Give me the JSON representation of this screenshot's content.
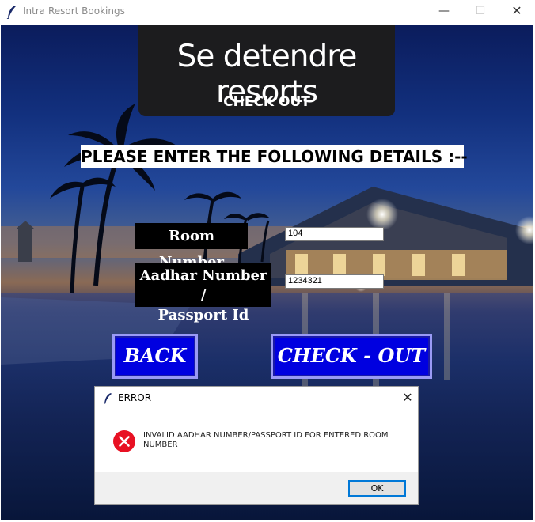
{
  "window": {
    "title": "Intra Resort Bookings",
    "icon": "feather-icon",
    "controls": {
      "minimize": "—",
      "maximize": "☐",
      "close": "✕"
    }
  },
  "header": {
    "brand": "Se detendre resorts",
    "subtitle": "CHECK OUT"
  },
  "form": {
    "prompt": "PLEASE ENTER THE FOLLOWING DETAILS :--",
    "room_label": "Room Number",
    "room_value": "104",
    "aadhar_label_line1": "Aadhar Number /",
    "aadhar_label_line2": "Passport Id",
    "aadhar_value": "1234321"
  },
  "buttons": {
    "back": "BACK",
    "checkout": "CHECK - OUT"
  },
  "dialog": {
    "title": "ERROR",
    "close": "✕",
    "icon": "error-icon",
    "message": "INVALID AADHAR NUMBER/PASSPORT ID FOR ENTERED ROOM NUMBER",
    "ok": "OK"
  },
  "colors": {
    "button_blue": "#0000e0",
    "header_bg": "#1c1c1e",
    "error_red": "#e81123",
    "dialog_focus": "#0078d7"
  }
}
